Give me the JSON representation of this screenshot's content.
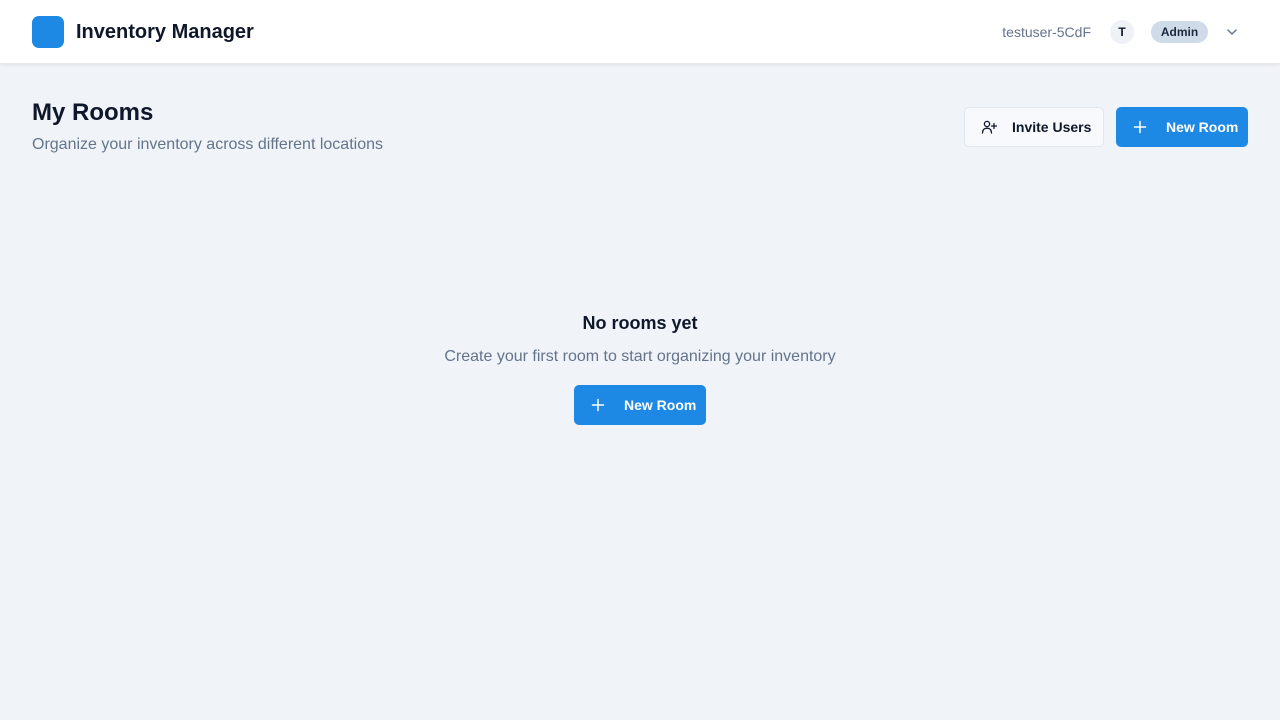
{
  "app": {
    "title": "Inventory Manager",
    "brand_color": "#1e88e5",
    "logo_icon": "app-logo-icon"
  },
  "user": {
    "username": "testuser-5CdF",
    "avatar_initial": "T",
    "role": "Admin",
    "menu_icon": "chevron-down-icon"
  },
  "page": {
    "title": "My Rooms",
    "subtitle": "Organize your inventory across different locations"
  },
  "actions": {
    "invite_label": "Invite Users",
    "invite_icon": "user-plus-icon",
    "new_room_label": "New Room",
    "new_room_icon": "plus-icon"
  },
  "empty_state": {
    "title": "No rooms yet",
    "description": "Create your first room to start organizing your inventory",
    "button_label": "New Room"
  }
}
